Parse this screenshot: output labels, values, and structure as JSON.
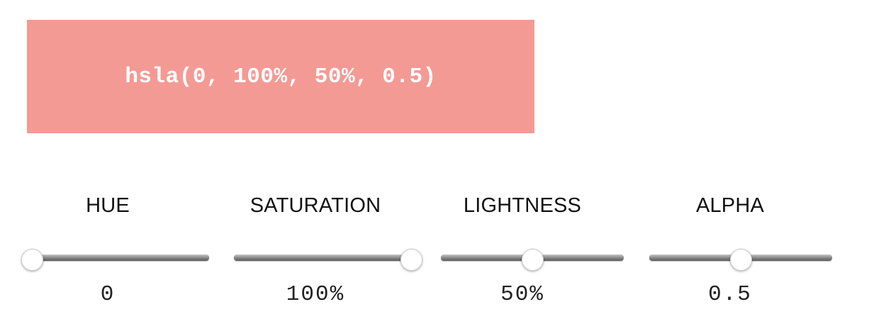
{
  "preview": {
    "text": "hsla(0, 100%, 50%, 0.5)",
    "background_color": "#f49a94",
    "text_color": "#ffffff"
  },
  "controls": [
    {
      "label": "HUE",
      "value_text": "0",
      "fraction": 0.0
    },
    {
      "label": "SATURATION",
      "value_text": "100%",
      "fraction": 1.0
    },
    {
      "label": "LIGHTNESS",
      "value_text": "50%",
      "fraction": 0.5
    },
    {
      "label": "ALPHA",
      "value_text": "0.5",
      "fraction": 0.5
    }
  ]
}
